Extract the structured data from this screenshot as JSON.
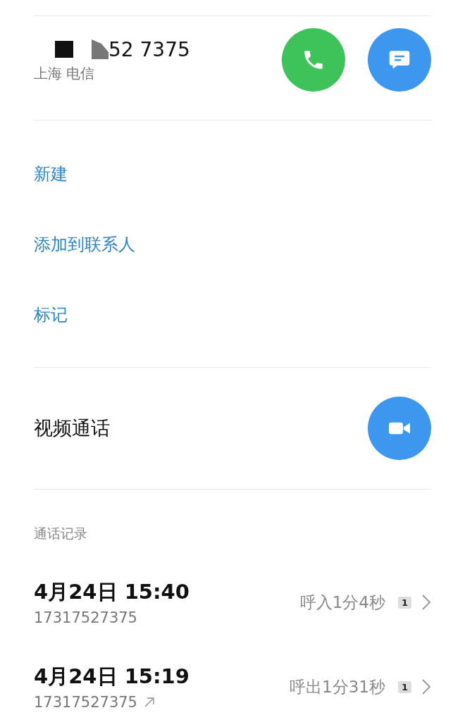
{
  "contact": {
    "number": "52 7375",
    "location": "上海 电信"
  },
  "actions": [
    {
      "label": "新建"
    },
    {
      "label": "添加到联系人"
    },
    {
      "label": "标记"
    }
  ],
  "video_call": {
    "label": "视频通话"
  },
  "call_log": {
    "title": "通话记录",
    "entries": [
      {
        "time": "4月24日 15:40",
        "number": "17317527375",
        "outgoing": false,
        "summary": "呼入1分4秒",
        "sim": "1"
      },
      {
        "time": "4月24日 15:19",
        "number": "17317527375",
        "outgoing": true,
        "summary": "呼出1分31秒",
        "sim": "1"
      }
    ]
  }
}
